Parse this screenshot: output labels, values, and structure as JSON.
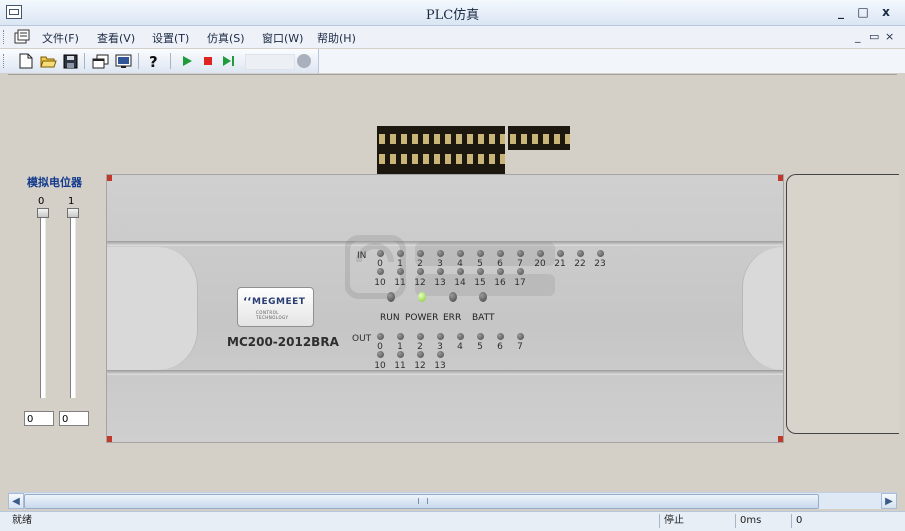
{
  "window": {
    "title": "PLC仿真",
    "controls": {
      "minimize": "_",
      "maximize": "□",
      "close": "x"
    }
  },
  "menubar": {
    "items": [
      {
        "label": "文件(F)"
      },
      {
        "label": "查看(V)"
      },
      {
        "label": "设置(T)"
      },
      {
        "label": "仿真(S)"
      },
      {
        "label": "窗口(W)"
      },
      {
        "label": "帮助(H)"
      }
    ],
    "mdi_controls": {
      "minimize": "_",
      "restore": "▭",
      "close": "×"
    }
  },
  "toolbar": {
    "icons": [
      "new-file-icon",
      "open-folder-icon",
      "save-icon",
      "windows-icon",
      "display-icon",
      "help-icon",
      "run-icon",
      "stop-icon",
      "step-run-icon",
      "refresh-icon"
    ]
  },
  "potentiometer": {
    "title": "模拟电位器",
    "channels": [
      {
        "label": "0",
        "value": "0"
      },
      {
        "label": "1",
        "value": "0"
      }
    ]
  },
  "plc": {
    "brand": "MEGMEET",
    "tagline": "CONTROL TECHNOLOGY",
    "model": "MC200-2012BRA",
    "in_label": "IN",
    "out_label": "OUT",
    "inputs_row1": [
      "0",
      "1",
      "2",
      "3",
      "4",
      "5",
      "6",
      "7",
      "20",
      "21",
      "22",
      "23"
    ],
    "inputs_row2": [
      "10",
      "11",
      "12",
      "13",
      "14",
      "15",
      "16",
      "17"
    ],
    "outputs_row1": [
      "0",
      "1",
      "2",
      "3",
      "4",
      "5",
      "6",
      "7"
    ],
    "outputs_row2": [
      "10",
      "11",
      "12",
      "13"
    ],
    "status_indicators": [
      {
        "label": "RUN",
        "state": "off"
      },
      {
        "label": "POWER",
        "state": "on"
      },
      {
        "label": "ERR",
        "state": "off"
      },
      {
        "label": "BATT",
        "state": "off"
      }
    ],
    "power_color": "#7ecb2a"
  },
  "statusbar": {
    "ready": "就绪",
    "state": "停止",
    "scan_time": "0ms",
    "counter": "0"
  }
}
